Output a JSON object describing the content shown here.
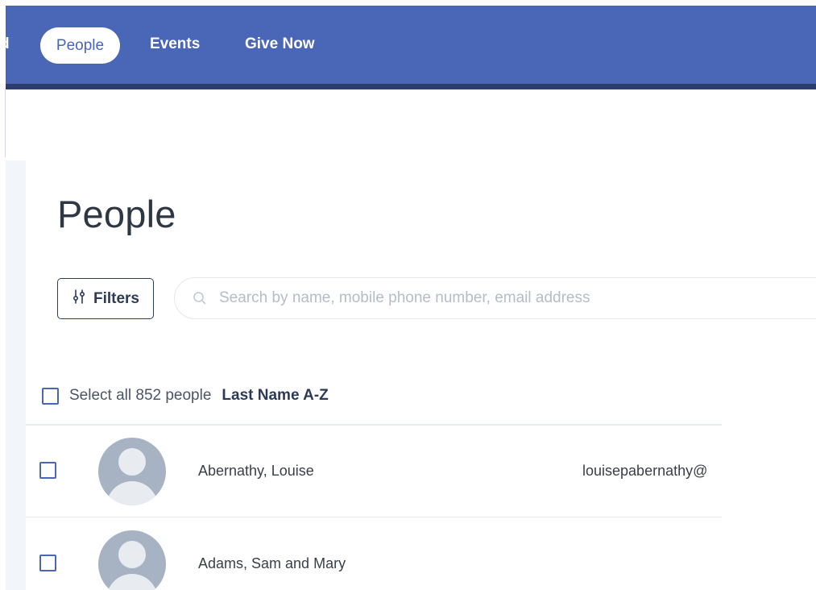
{
  "nav": {
    "edge_label": "d",
    "items": [
      {
        "label": "People",
        "active": true
      },
      {
        "label": "Events",
        "active": false
      },
      {
        "label": "Give Now",
        "active": false
      }
    ],
    "colors": {
      "bar": "#4a66b6",
      "bar_border": "#2c3d6e"
    }
  },
  "page": {
    "title": "People"
  },
  "toolbar": {
    "filters_label": "Filters",
    "filters_icon": "sliders-icon",
    "search_icon": "search-icon",
    "search_placeholder": "Search by name, mobile phone number, email address",
    "search_value": ""
  },
  "list": {
    "select_all_label": "Select all 852 people",
    "sort_label": "Last Name A-Z",
    "people": [
      {
        "name": "Abernathy, Louise",
        "email": "louisepabernathy@",
        "avatar": "avatar-placeholder-icon",
        "checked": false
      },
      {
        "name": "Adams, Sam and Mary",
        "email": "",
        "avatar": "avatar-placeholder-icon",
        "checked": false
      }
    ]
  }
}
